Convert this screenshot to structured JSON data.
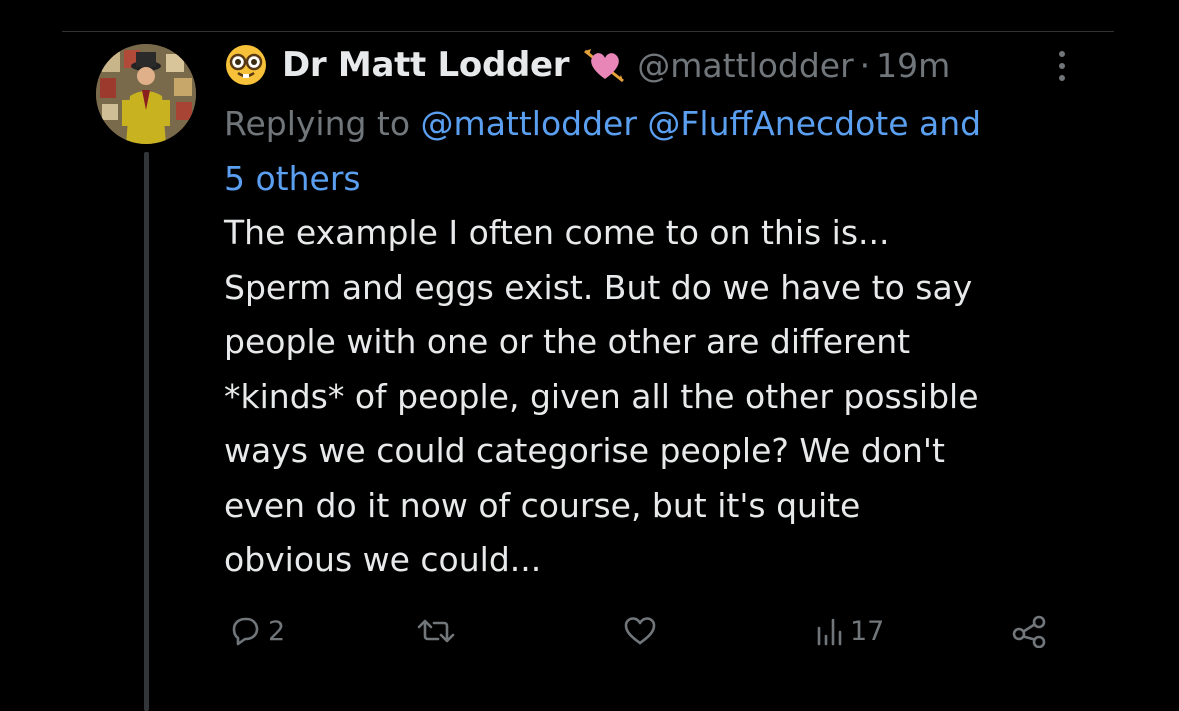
{
  "tweet": {
    "display_name": "Dr Matt Lodder",
    "handle": "@mattlodder",
    "separator": "·",
    "time": "19m",
    "reply": {
      "prefix": "Replying to",
      "mention1": "@mattlodder",
      "mention2": "@FluffAnecdote",
      "and_text": "and",
      "others": "5 others"
    },
    "body_lines": [
      "The example I often come to on this is...",
      "Sperm and eggs exist. But do we have to say",
      "people with one or the other are different",
      "*kinds* of people, given all the other possible",
      "ways we could categorise people? We don't",
      "even do it now of course, but it's quite",
      "obvious we could..."
    ],
    "actions": {
      "reply_count": "2",
      "retweet_count": "",
      "like_count": "",
      "views_count": "17"
    },
    "icons": {
      "name_emoji": "nerd-face-icon",
      "name_badge": "heart-with-arrow-icon",
      "more": "more-vertical-icon",
      "reply": "reply-icon",
      "retweet": "retweet-icon",
      "like": "like-icon",
      "views": "views-icon",
      "share": "share-icon"
    },
    "colors": {
      "background": "#000000",
      "text": "#e7e9ea",
      "muted": "#71767b",
      "link": "#5b9ff0"
    }
  }
}
